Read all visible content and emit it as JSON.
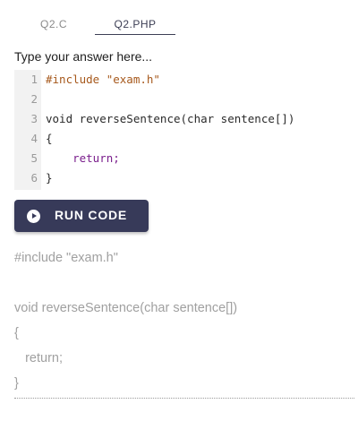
{
  "tabs": [
    {
      "label": "Q2.C",
      "active": false
    },
    {
      "label": "Q2.PHP",
      "active": true
    }
  ],
  "prompt": "Type your answer here...",
  "editor": {
    "lines": [
      {
        "num": "1",
        "text": "#include \"exam.h\""
      },
      {
        "num": "2",
        "text": ""
      },
      {
        "num": "3",
        "text": "void reverseSentence(char sentence[])"
      },
      {
        "num": "4",
        "text": "{"
      },
      {
        "num": "5",
        "text": "    return;"
      },
      {
        "num": "6",
        "text": "}"
      }
    ]
  },
  "run_button": {
    "label": "RUN CODE",
    "icon": "play-circle-icon"
  },
  "preview": {
    "lines": [
      "#include \"exam.h\"",
      "",
      "void reverseSentence(char sentence[])",
      "{",
      "   return;",
      "}"
    ]
  },
  "colors": {
    "accent": "#373a59",
    "preprocessor": "#a6581b",
    "keyword": "#7a1e8c",
    "muted_text": "#a0a0a0"
  }
}
